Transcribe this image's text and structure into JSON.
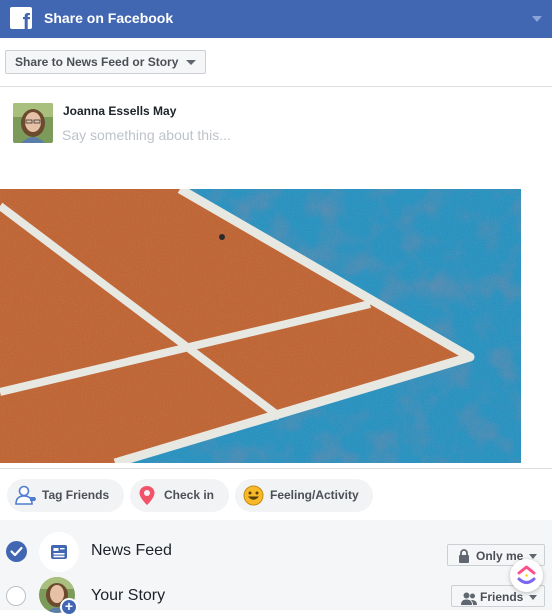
{
  "dialog": {
    "title": "Share on Facebook",
    "brand_color": "#4267b2"
  },
  "share_target": {
    "label": "Share to News Feed or Story"
  },
  "composer": {
    "user_name": "Joanna Essells May",
    "placeholder": "Say something about this..."
  },
  "attachment": {
    "court_orange": "#c05f2b",
    "court_blue": "#1e8fc0",
    "line_color": "#e8e8e2"
  },
  "actions": [
    {
      "label": "Tag Friends",
      "icon": "tag-friends-icon"
    },
    {
      "label": "Check in",
      "icon": "location-pin-icon"
    },
    {
      "label": "Feeling/Activity",
      "icon": "smiley-icon"
    }
  ],
  "destinations": [
    {
      "label": "News Feed",
      "checked": true,
      "privacy": "Only me",
      "privacy_icon": "lock-icon"
    },
    {
      "label": "Your Story",
      "checked": false,
      "privacy": "Friends",
      "privacy_icon": "friends-icon"
    }
  ]
}
